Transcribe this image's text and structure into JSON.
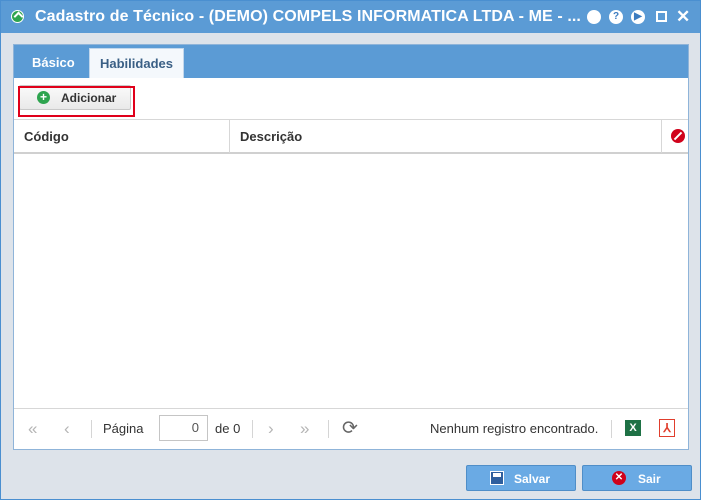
{
  "window": {
    "title": "Cadastro de Técnico - (DEMO) COMPELS INFORMATICA LTDA - ME - ..."
  },
  "title_buttons": {
    "minimize_icon": "minimize-icon",
    "help_icon": "help-icon",
    "help_glyph": "?",
    "play_icon": "play-icon",
    "maximize_icon": "maximize-icon",
    "close_icon": "close-icon",
    "close_glyph": "✕"
  },
  "tabs": [
    {
      "label": "Básico",
      "active": false
    },
    {
      "label": "Habilidades",
      "active": true
    }
  ],
  "toolbar": {
    "add_label": "Adicionar",
    "add_glyph": "+"
  },
  "grid": {
    "columns": [
      "Código",
      "Descrição"
    ],
    "rows": []
  },
  "pager": {
    "first_glyph": "«",
    "prev_glyph": "‹",
    "next_glyph": "›",
    "last_glyph": "»",
    "page_label": "Página",
    "page_value": "0",
    "of_label": "de 0",
    "refresh_glyph": "⟳",
    "status": "Nenhum registro encontrado.",
    "xls_glyph": "X",
    "pdf_glyph": "⅄"
  },
  "footer": {
    "save_label": "Salvar",
    "exit_label": "Sair",
    "exit_glyph": "✕"
  },
  "colors": {
    "titlebar": "#5b9bd5",
    "accent_button": "#6aaae4",
    "highlight": "#e0001a"
  }
}
